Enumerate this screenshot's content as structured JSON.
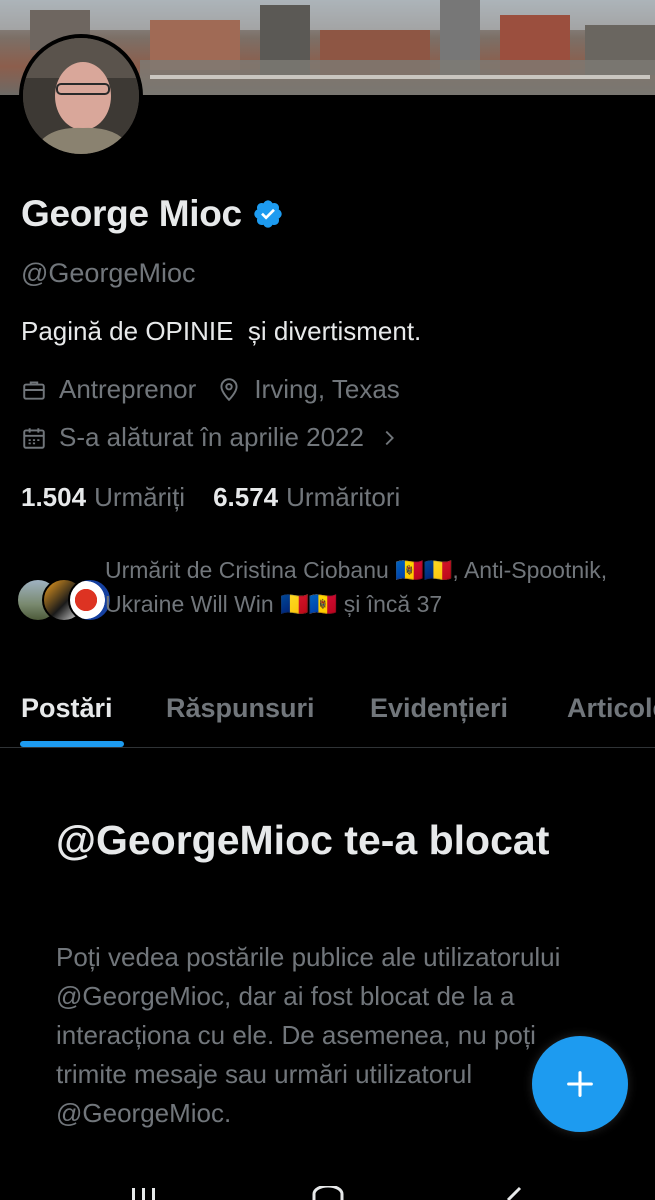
{
  "profile": {
    "name": "George Mioc",
    "handle": "@GeorgeMioc",
    "bio": "Pagină de OPINIE  și divertisment.",
    "profession": "Antreprenor",
    "location": "Irving, Texas",
    "joined": "S-a alăturat în aprilie 2022"
  },
  "stats": {
    "following_count": "1.504",
    "following_label": "Urmăriți",
    "followers_count": "6.574",
    "followers_label": "Urmăritori"
  },
  "followed_by": {
    "text": "Urmărit de Cristina Ciobanu 🇲🇩🇷🇴, Anti-Spootnik, Ukraine Will Win 🇷🇴🇲🇩 și încă 37"
  },
  "tabs": [
    {
      "label": "Postări",
      "active": true
    },
    {
      "label": "Răspunsuri",
      "active": false
    },
    {
      "label": "Evidențieri",
      "active": false
    },
    {
      "label": "Articole",
      "active": false
    }
  ],
  "blocked": {
    "title": "@GeorgeMioc te-a blocat",
    "message": "Poți vedea postările publice ale utilizatorului @GeorgeMioc, dar ai fost blocat de la a interacționa cu ele. De asemenea, nu poți trimite mesaje sau urmări utilizatorul @GeorgeMioc."
  },
  "icons": {
    "verified": "verified-badge-icon",
    "profession": "briefcase-icon",
    "location": "location-pin-icon",
    "joined": "calendar-icon",
    "joined_more": "chevron-right-icon",
    "fab": "plus-icon"
  },
  "colors": {
    "accent": "#1d9bf0",
    "text_primary": "#e7e9ea",
    "text_secondary": "#71767b",
    "background": "#000000"
  }
}
